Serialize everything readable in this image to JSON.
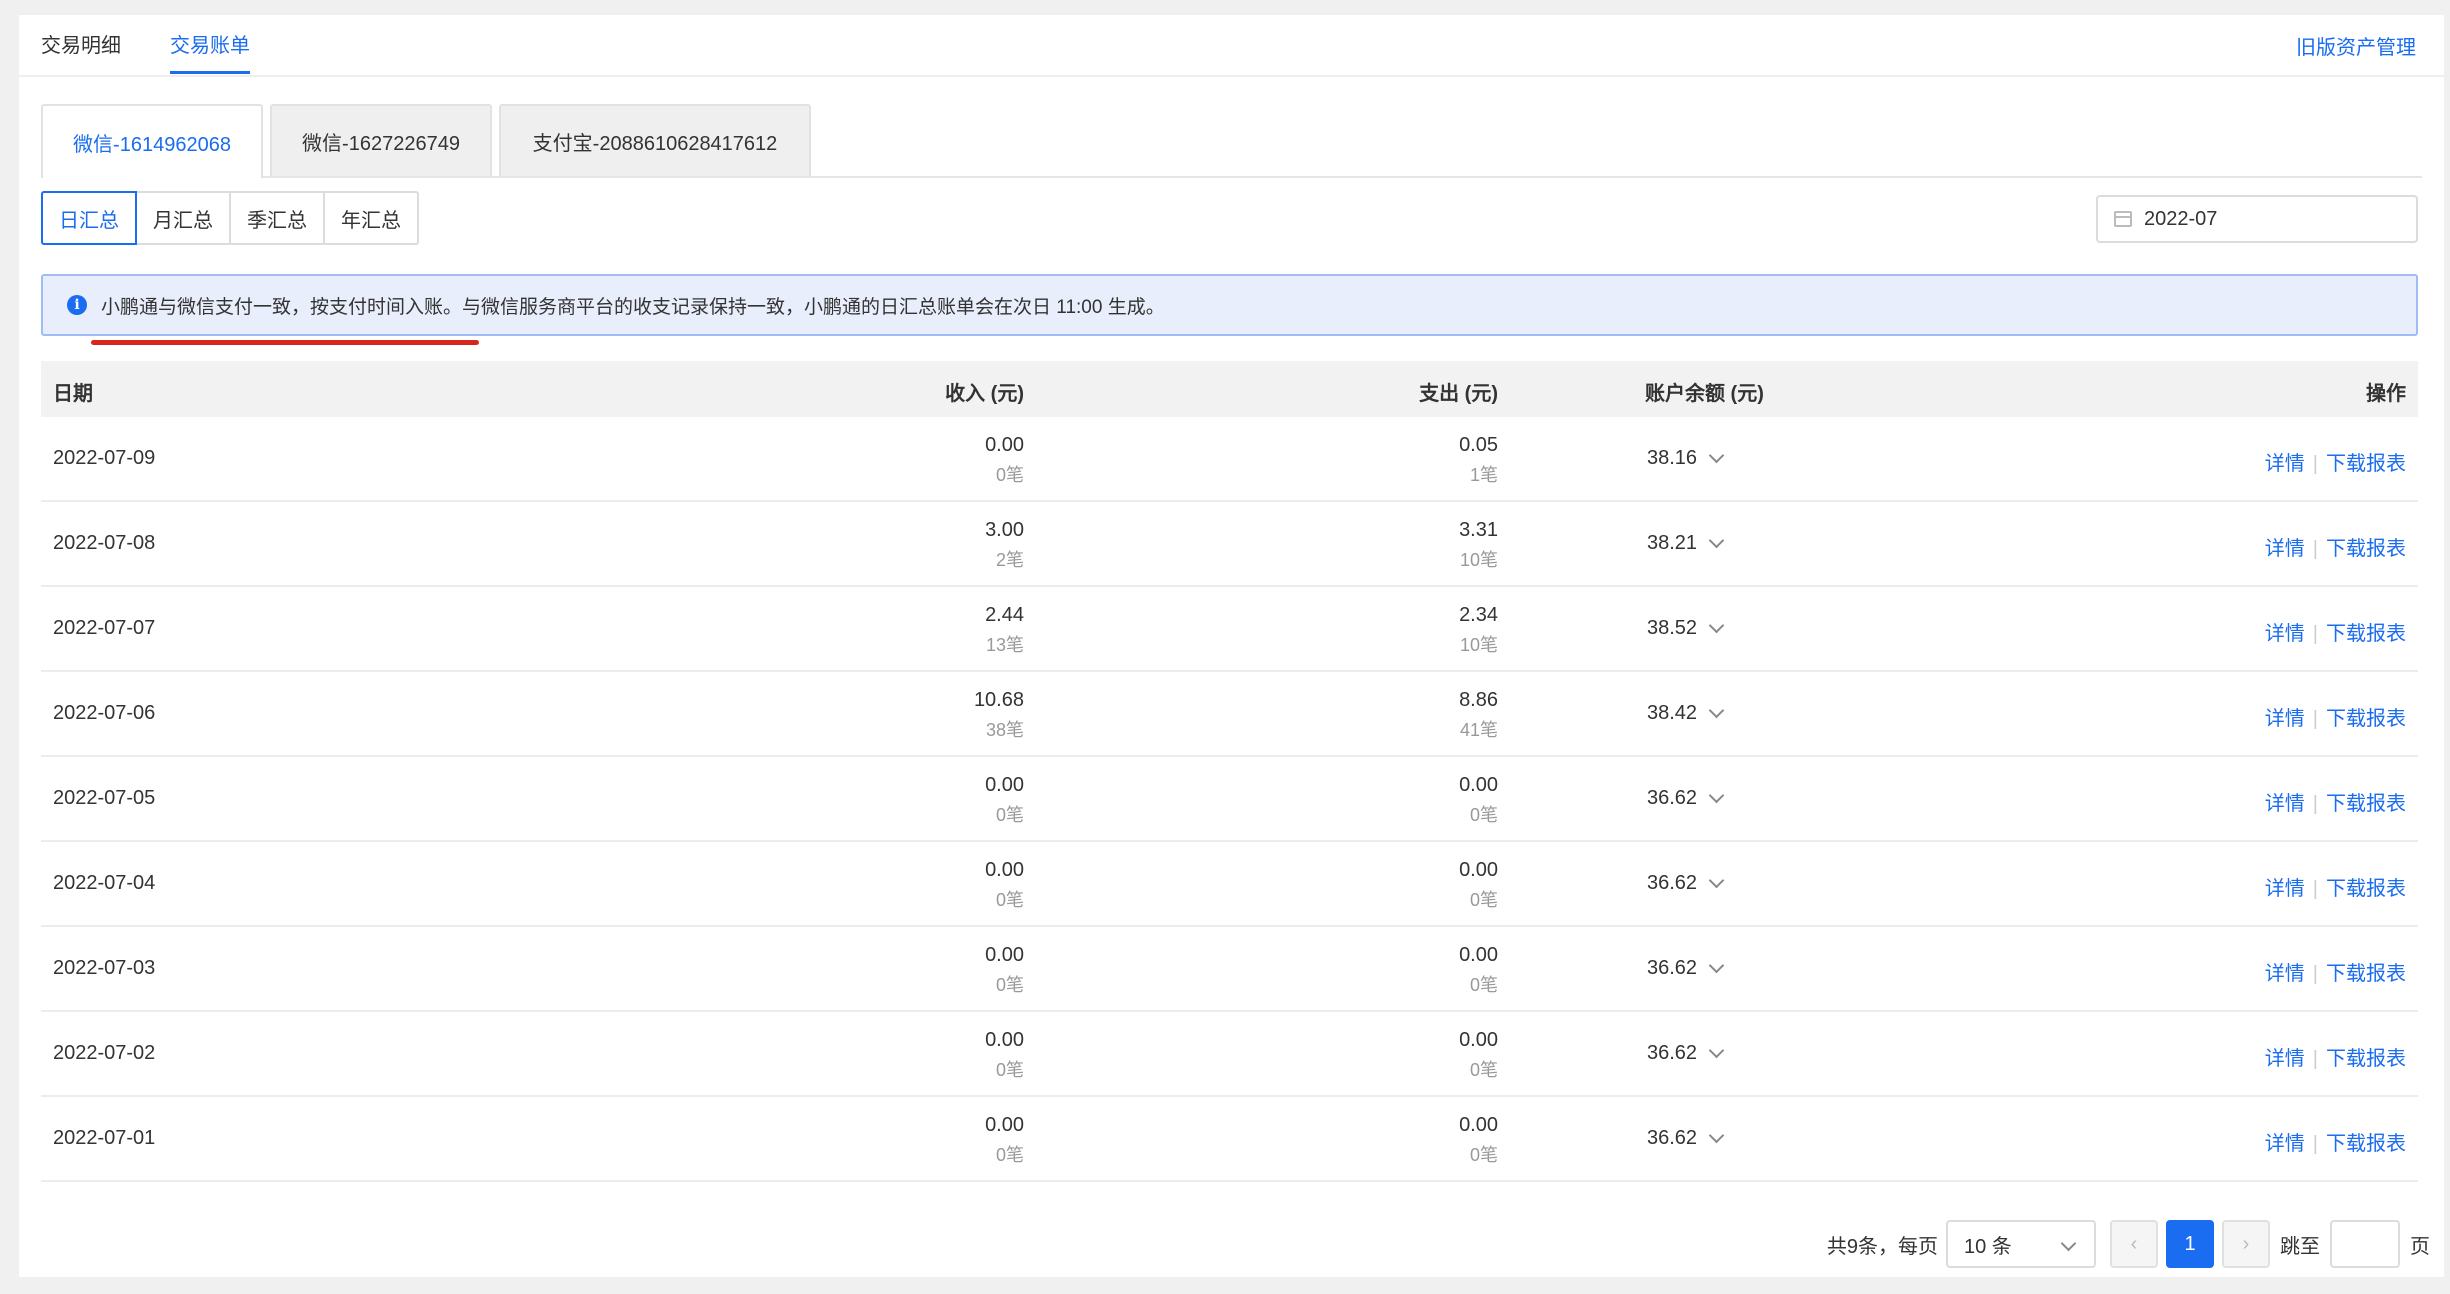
{
  "top_nav": {
    "tabs": [
      {
        "label": "交易明细",
        "active": false
      },
      {
        "label": "交易账单",
        "active": true
      }
    ],
    "legacy_link": "旧版资产管理"
  },
  "account_tabs": [
    {
      "label": "微信-1614962068",
      "active": true
    },
    {
      "label": "微信-1627226749",
      "active": false
    },
    {
      "label": "支付宝-2088610628417612",
      "active": false
    }
  ],
  "period_tabs": [
    {
      "label": "日汇总",
      "active": true
    },
    {
      "label": "月汇总",
      "active": false
    },
    {
      "label": "季汇总",
      "active": false
    },
    {
      "label": "年汇总",
      "active": false
    }
  ],
  "date_picker": {
    "value": "2022-07",
    "icon": "calendar-icon"
  },
  "banner": {
    "icon": "info-icon",
    "text": "小鹏通与微信支付一致，按支付时间入账。与微信服务商平台的收支记录保持一致，小鹏通的日汇总账单会在次日 11:00 生成。"
  },
  "table": {
    "headers": {
      "date": "日期",
      "income": "收入 (元)",
      "expense": "支出 (元)",
      "balance": "账户余额 (元)",
      "actions": "操作"
    },
    "rows": [
      {
        "date": "2022-07-09",
        "income": "0.00",
        "income_count": "0笔",
        "expense": "0.05",
        "expense_count": "1笔",
        "balance": "38.16"
      },
      {
        "date": "2022-07-08",
        "income": "3.00",
        "income_count": "2笔",
        "expense": "3.31",
        "expense_count": "10笔",
        "balance": "38.21"
      },
      {
        "date": "2022-07-07",
        "income": "2.44",
        "income_count": "13笔",
        "expense": "2.34",
        "expense_count": "10笔",
        "balance": "38.52"
      },
      {
        "date": "2022-07-06",
        "income": "10.68",
        "income_count": "38笔",
        "expense": "8.86",
        "expense_count": "41笔",
        "balance": "38.42"
      },
      {
        "date": "2022-07-05",
        "income": "0.00",
        "income_count": "0笔",
        "expense": "0.00",
        "expense_count": "0笔",
        "balance": "36.62"
      },
      {
        "date": "2022-07-04",
        "income": "0.00",
        "income_count": "0笔",
        "expense": "0.00",
        "expense_count": "0笔",
        "balance": "36.62"
      },
      {
        "date": "2022-07-03",
        "income": "0.00",
        "income_count": "0笔",
        "expense": "0.00",
        "expense_count": "0笔",
        "balance": "36.62"
      },
      {
        "date": "2022-07-02",
        "income": "0.00",
        "income_count": "0笔",
        "expense": "0.00",
        "expense_count": "0笔",
        "balance": "36.62"
      },
      {
        "date": "2022-07-01",
        "income": "0.00",
        "income_count": "0笔",
        "expense": "0.00",
        "expense_count": "0笔",
        "balance": "36.62"
      }
    ],
    "action_detail": "详情",
    "action_download": "下载报表"
  },
  "pagination": {
    "summary": "共9条，每页",
    "page_size": "10 条",
    "prev_icon": "chevron-left-icon",
    "current_page": "1",
    "next_icon": "chevron-right-icon",
    "jump_label": "跳至",
    "jump_suffix": "页"
  },
  "colors": {
    "accent": "#1a6cf0",
    "banner_bg": "#e8eefc",
    "annotation": "#d9261c"
  }
}
